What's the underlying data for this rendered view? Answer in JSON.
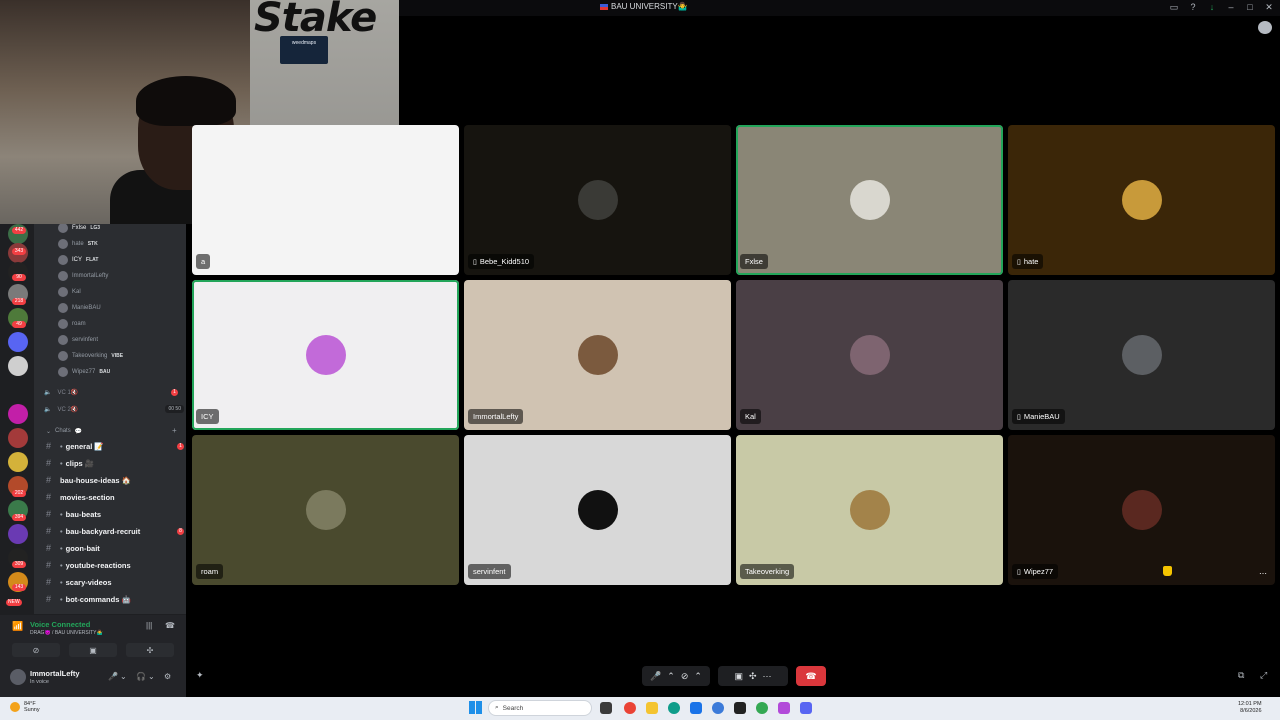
{
  "window": {
    "title": "BAU UNIVERSITY🤷‍♂️"
  },
  "voice_users": [
    {
      "name": "Fxlse",
      "tag": "LG3",
      "bright": true
    },
    {
      "name": "hate",
      "tag": "STK",
      "bright": false
    },
    {
      "name": "ICY",
      "tag": "FLAT",
      "bright": true
    },
    {
      "name": "ImmortalLefty",
      "tag": "",
      "bright": false
    },
    {
      "name": "Kal",
      "tag": "",
      "bright": false
    },
    {
      "name": "ManieBAU",
      "tag": "",
      "bright": false
    },
    {
      "name": "roam",
      "tag": "",
      "bright": false
    },
    {
      "name": "servinfent",
      "tag": "",
      "bright": false
    },
    {
      "name": "Takeoverking",
      "tag": "VIBE",
      "bright": false
    },
    {
      "name": "Wipez77",
      "tag": "BAU",
      "bright": false
    }
  ],
  "sub_voice": [
    {
      "name": "VC 1🔇",
      "count": ""
    },
    {
      "name": "VC 2🔇",
      "count": "00 50"
    }
  ],
  "category": {
    "name": "Chats",
    "emoji": "💬"
  },
  "channels": [
    {
      "name": "general 📝",
      "badge": "1",
      "bullet": "•"
    },
    {
      "name": "clips 🎥",
      "badge": "",
      "bullet": "•"
    },
    {
      "name": "bau-house-ideas 🏠",
      "badge": "",
      "bullet": ""
    },
    {
      "name": "movies-section",
      "badge": "",
      "bullet": ""
    },
    {
      "name": "bau-beats",
      "badge": "",
      "bullet": "•"
    },
    {
      "name": "bau-backyard-recruit",
      "badge": "8",
      "bullet": "•"
    },
    {
      "name": "goon-bait",
      "badge": "",
      "bullet": "•"
    },
    {
      "name": "youtube-reactions",
      "badge": "",
      "bullet": "•"
    },
    {
      "name": "scary-videos",
      "badge": "",
      "bullet": "•"
    },
    {
      "name": "bot-commands 🤖",
      "badge": "",
      "bullet": "•"
    }
  ],
  "server_badges": [
    "442",
    "343",
    "90",
    "218",
    "49",
    "202",
    "394",
    "309",
    "143",
    "NEW"
  ],
  "voice_panel": {
    "status": "Voice Connected",
    "sub": "DRAG😈 / BAU UNIVERSITY🤷‍♂️"
  },
  "user_panel": {
    "name": "ImmortalLefty",
    "status": "In voice"
  },
  "webcam": {
    "logo": "Stake",
    "sign": "weedmaps"
  },
  "tiles": [
    {
      "name": "a",
      "mobile": false,
      "bg": "#f4f4f4",
      "av": "",
      "speaking": false
    },
    {
      "name": "Bebe_Kidd510",
      "mobile": true,
      "bg": "#16140f",
      "av": "#3a3a36",
      "speaking": false
    },
    {
      "name": "Fxlse",
      "mobile": false,
      "bg": "#8a8676",
      "av": "#d9d7cf",
      "speaking": true
    },
    {
      "name": "hate",
      "mobile": true,
      "bg": "#3b2608",
      "av": "#c89a3a",
      "speaking": false
    },
    {
      "name": "ICY",
      "mobile": false,
      "bg": "#f0eff1",
      "av": "#c26ad9",
      "speaking": true
    },
    {
      "name": "ImmortalLefty",
      "mobile": false,
      "bg": "#d0c3b2",
      "av": "#7b5a3e",
      "speaking": false
    },
    {
      "name": "Kal",
      "mobile": false,
      "bg": "#4a3f45",
      "av": "#7e6470",
      "speaking": false
    },
    {
      "name": "ManieBAU",
      "mobile": true,
      "bg": "#2a2a2a",
      "av": "#5c5f63",
      "speaking": false
    },
    {
      "name": "roam",
      "mobile": false,
      "bg": "#4a4a2e",
      "av": "#7b7a5e",
      "speaking": false
    },
    {
      "name": "servinfent",
      "mobile": false,
      "bg": "#d8d8d8",
      "av": "#111111",
      "speaking": false
    },
    {
      "name": "Takeoverking",
      "mobile": false,
      "bg": "#c8c9a6",
      "av": "#a3834a",
      "speaking": false
    },
    {
      "name": "Wipez77",
      "mobile": true,
      "bg": "#1a120c",
      "av": "#5a2820",
      "speaking": false
    }
  ],
  "taskbar": {
    "weather_temp": "84°F",
    "weather_desc": "Sunny",
    "search_placeholder": "Search",
    "time": "12:01 PM",
    "date": "8/6/2026"
  },
  "colors": {
    "accent_green": "#23a55a",
    "hangup_red": "#da373c",
    "badge_red": "#f23f43"
  }
}
